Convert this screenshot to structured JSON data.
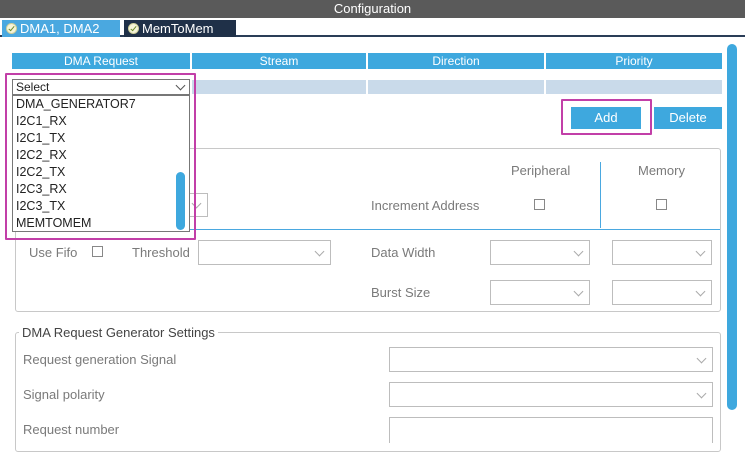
{
  "window": {
    "title": "Configuration"
  },
  "tabs": [
    {
      "label": "DMA1, DMA2",
      "state": "active"
    },
    {
      "label": "MemToMem",
      "state": "inactive"
    }
  ],
  "table": {
    "headers": [
      "DMA Request",
      "Stream",
      "Direction",
      "Priority"
    ]
  },
  "dropdown": {
    "selected": "Select",
    "options": [
      "DMA_GENERATOR7",
      "I2C1_RX",
      "I2C1_TX",
      "I2C2_RX",
      "I2C2_TX",
      "I2C3_RX",
      "I2C3_TX",
      "MEMTOMEM"
    ]
  },
  "buttons": {
    "add": "Add",
    "delete": "Delete"
  },
  "dma_settings": {
    "peripheral_header": "Peripheral",
    "memory_header": "Memory",
    "increment_address": "Increment Address",
    "use_fifo": "Use Fifo",
    "threshold": "Threshold",
    "data_width": "Data Width",
    "burst_size": "Burst Size"
  },
  "generator": {
    "title": "DMA Request Generator Settings",
    "request_signal": "Request generation Signal",
    "signal_polarity": "Signal polarity",
    "request_number": "Request number"
  },
  "colors": {
    "accent": "#3ea8de",
    "highlight": "#c23fa8",
    "titlebar": "#5a5a5a",
    "tab_inactive": "#1f3048"
  }
}
